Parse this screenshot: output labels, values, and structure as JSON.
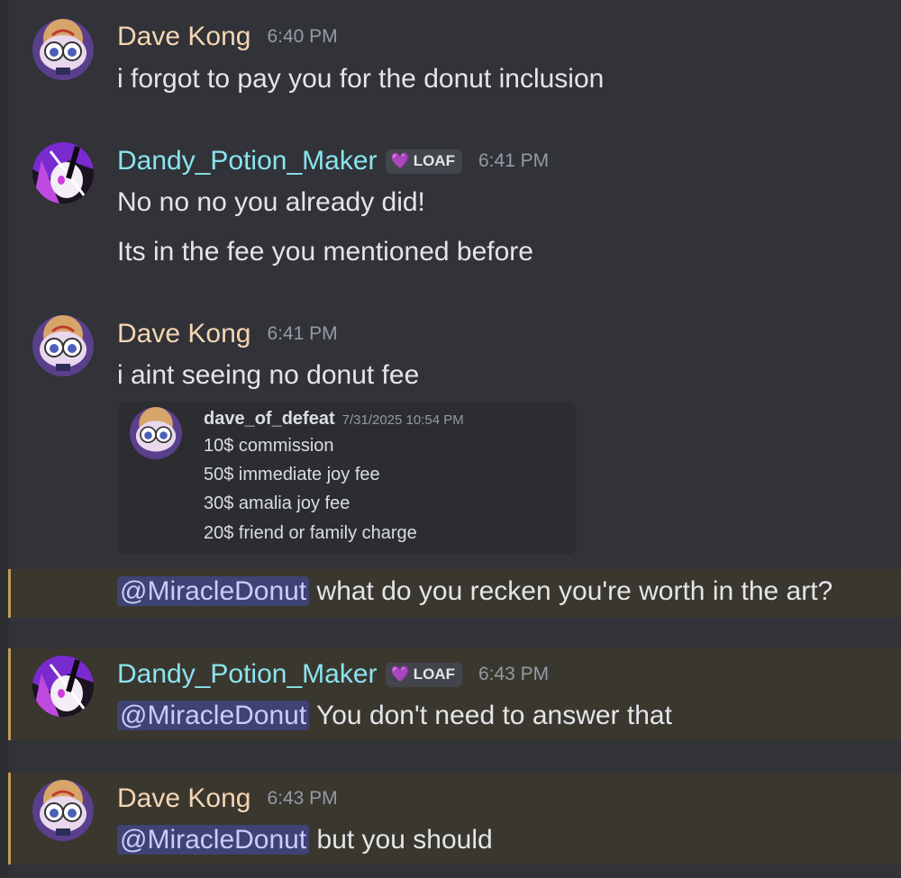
{
  "messages": [
    {
      "author": "Dave Kong",
      "time": "6:40 PM",
      "lines": [
        "i forgot to pay you for the donut inclusion"
      ]
    },
    {
      "author": "Dandy_Potion_Maker",
      "tag": "LOAF",
      "time": "6:41 PM",
      "lines": [
        "No no no you already did!",
        "Its in the fee you mentioned before"
      ]
    },
    {
      "author": "Dave Kong",
      "time": "6:41 PM",
      "lines": [
        "i aint seeing no donut fee"
      ],
      "embed": {
        "author": "dave_of_defeat",
        "time": "7/31/2025 10:54 PM",
        "lines": [
          "10$ commission",
          "50$ immediate joy fee",
          "30$ amalia joy fee",
          "20$ friend or family charge"
        ]
      },
      "followup": {
        "mention": "@MiracleDonut",
        "text": " what do you recken you're worth in the art?"
      }
    },
    {
      "author": "Dandy_Potion_Maker",
      "tag": "LOAF",
      "time": "6:43 PM",
      "mention": "@MiracleDonut",
      "text": " You don't need to answer that"
    },
    {
      "author": "Dave Kong",
      "time": "6:43 PM",
      "mention": "@MiracleDonut",
      "text": " but you should"
    }
  ],
  "colors": {
    "background": "#313338",
    "dave_name": "#f5d6b2",
    "dandy_name": "#8be4ef",
    "mention_bg": "#3a372f",
    "mention_bar": "#c29a5a",
    "mention_pill": "#3e4373"
  }
}
